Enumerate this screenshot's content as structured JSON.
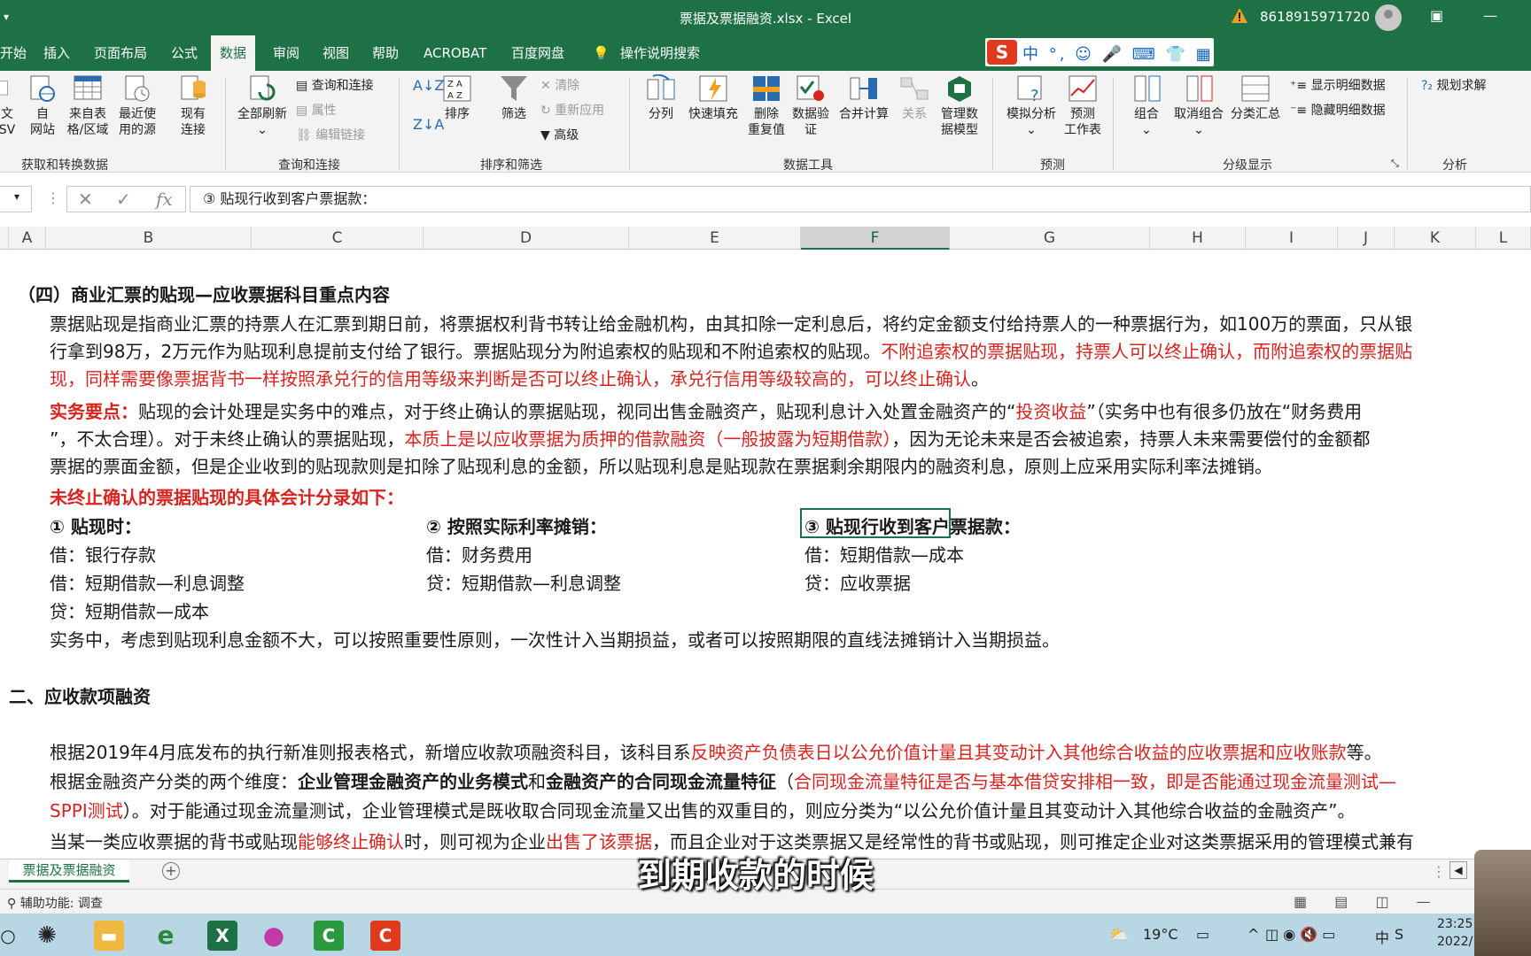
{
  "window": {
    "title": "票据及票据融资.xlsx  -  Excel",
    "account": "8618915971720",
    "minimize": "—",
    "restore": "▣"
  },
  "tabs": [
    {
      "label": "开始"
    },
    {
      "label": "插入"
    },
    {
      "label": "页面布局"
    },
    {
      "label": "公式"
    },
    {
      "label": "数据"
    },
    {
      "label": "审阅"
    },
    {
      "label": "视图"
    },
    {
      "label": "帮助"
    },
    {
      "label": "ACROBAT"
    },
    {
      "label": "百度网盘"
    },
    {
      "label": "操作说明搜索"
    }
  ],
  "ime": {
    "logo": "S",
    "items": "中 °, ☺ 🎤 ⌨ 👕 ▦"
  },
  "ribbon": {
    "from_csv": "文\nSV",
    "from_web": "自\n网站",
    "from_table": "来自表\n格/区域",
    "recent": "最近使\n用的源",
    "existing": "现有\n连接",
    "group_get": "获取和转换数据",
    "refresh_all": "全部刷新",
    "query_conn": "查询和连接",
    "properties": "属性",
    "edit_links": "编辑链接",
    "group_query": "查询和连接",
    "sort": "排序",
    "filter": "筛选",
    "clear": "清除",
    "reapply": "重新应用",
    "advanced": "高级",
    "group_sort": "排序和筛选",
    "split": "分列",
    "flash_fill": "快速填充",
    "remove_dup": "删除\n重复值",
    "validation": "数据验\n证",
    "consolidate": "合并计算",
    "relations": "关系",
    "data_model": "管理数\n据模型",
    "group_tools": "数据工具",
    "whatif": "模拟分析",
    "forecast": "预测\n工作表",
    "group_forecast": "预测",
    "group_btn": "组合",
    "ungroup": "取消组合",
    "subtotal": "分类汇总",
    "show_detail": "显示明细数据",
    "hide_detail": "隐藏明细数据",
    "group_outline": "分级显示",
    "solver": "规划求解",
    "group_analysis": "分析"
  },
  "formula": {
    "content": "③ 贴现行收到客户票据款："
  },
  "columns": [
    "A",
    "B",
    "C",
    "D",
    "E",
    "F",
    "G",
    "H",
    "I",
    "J",
    "K",
    "L"
  ],
  "sheet": {
    "h1": "（四）商业汇票的贴现—应收票据科目重点内容",
    "p1a": "票据贴现是指商业汇票的持票人在汇票到期日前，将票据权利背书转让给金融机构，由其扣除一定利息后，将约定金额支付给持票人的一种票据行为，如100万的票面，只从银",
    "p1b_black": "行拿到98万，2万元作为贴现利息提前支付给了银行。票据贴现分为附追索权的贴现和不附追索权的贴现。",
    "p1b_red": "不附追索权的票据贴现，持票人可以终止确认，而附追索权的票据贴",
    "p1c_red": "现，同样需要像票据背书一样按照承兑行的信用等级来判断是否可以终止确认，承兑行信用等级较高的，可以终止确认",
    "p1c_end": "。",
    "p2a_red": "实务要点：",
    "p2a_black": "贴现的会计处理是实务中的难点，对于终止确认的票据贴现，视同出售金融资产，贴现利息计入处置金融资产的“",
    "p2a_red2": "投资收益",
    "p2a_black2": "”（实务中也有很多仍放在“财务费用",
    "p2b_black": "”，不太合理）。对于未终止确认的票据贴现，",
    "p2b_red": "本质上是以应收票据为质押的借款融资（一般披露为短期借款）",
    "p2b_black2": "，因为无论未来是否会被追索，持票人未来需要偿付的金额都",
    "p2c": "票据的票面金额，但是企业收到的贴现款则是扣除了贴现利息的金额，所以贴现利息是贴现款在票据剩余期限内的融资利息，原则上应采用实际利率法摊销。",
    "h2": "未终止确认的票据贴现的具体会计分录如下：",
    "e1_title": "① 贴现时：",
    "e1_l1": "借：银行存款",
    "e1_l2": "借：短期借款—利息调整",
    "e1_l3": "贷：短期借款—成本",
    "e2_title": "② 按照实际利率摊销：",
    "e2_l1": "借：财务费用",
    "e2_l2": "贷：短期借款—利息调整",
    "e3_title": "③ 贴现行收到客户票据款：",
    "e3_l1": "借：短期借款—成本",
    "e3_l2": "贷：应收票据",
    "p3": "实务中，考虑到贴现利息金额不大，可以按照重要性原则，一次性计入当期损益，或者可以按照期限的直线法摊销计入当期损益。",
    "h3": "二、应收款项融资",
    "p4_black": "根据2019年4月底发布的执行新准则报表格式，新增应收款项融资科目，该科目系",
    "p4_red": "反映资产负债表日以公允价值计量且其变动计入其他综合收益的应收票据和应收账款",
    "p4_end": "等。",
    "p5_black": "根据金融资产分类的两个维度：",
    "p5_bold1": "企业管理金融资产的业务模式",
    "p5_and": "和",
    "p5_bold2": "金融资产的合同现金流量特征",
    "p5_paren": "（",
    "p5_red": "合同现金流量特征是否与基本借贷安排相一致，即是否能通过现金流量测试—",
    "p6_red": "SPPI测试",
    "p6_black": "）。对于能通过现金流量测试，企业管理模式是既收取合同现金流量又出售的双重目的，则应分类为“以公允价值计量且其变动计入其他综合收益的金融资产”。",
    "p7_a": "当某一类应收票据的背书或贴现",
    "p7_r1": "能够终止确认",
    "p7_b": "时，则可视为企业",
    "p7_r2": "出售了该票据",
    "p7_c": "，而且企业对于这类票据又是经常性的背书或贴现，则可推定企业对这类票据采用的管理模式兼有"
  },
  "sheet_tab": "票据及票据融资",
  "status": {
    "accessibility": "辅助功能: 调查"
  },
  "caption": "到期收款的时候",
  "taskbar": {
    "weather": "19°C",
    "lang": "中",
    "time": "23:25",
    "date": "2022/"
  }
}
